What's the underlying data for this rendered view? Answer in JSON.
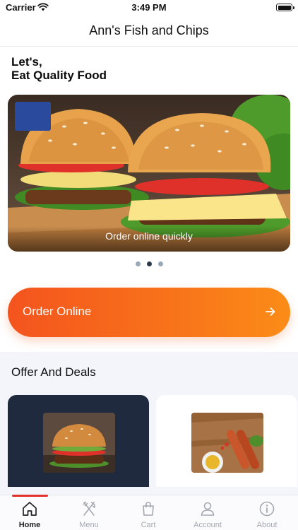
{
  "status_bar": {
    "carrier": "Carrier",
    "time": "3:49 PM"
  },
  "header": {
    "title": "Ann's Fish and Chips"
  },
  "hero": {
    "greeting_line1": "Let's,",
    "greeting_line2": "Eat Quality Food"
  },
  "banner": {
    "caption": "Order online quickly",
    "active_slide": 2,
    "slide_count": 3
  },
  "order_button": {
    "label": "Order Online",
    "icon": "arrow-right-icon"
  },
  "offers": {
    "title": "Offer And Deals",
    "cards": [
      {
        "image": "burger-photo"
      },
      {
        "image": "sausage-photo"
      }
    ]
  },
  "tabs": [
    {
      "label": "Home",
      "icon": "home-icon",
      "active": true
    },
    {
      "label": "Menu",
      "icon": "fork-knife-icon",
      "active": false
    },
    {
      "label": "Cart",
      "icon": "shopping-bag-icon",
      "active": false
    },
    {
      "label": "Account",
      "icon": "user-icon",
      "active": false
    },
    {
      "label": "About",
      "icon": "info-icon",
      "active": false
    }
  ],
  "colors": {
    "accent_start": "#f4541e",
    "accent_end": "#fb8c17",
    "tab_active_indicator": "#e0312b",
    "deal_card_dark": "#1f2a3f"
  }
}
